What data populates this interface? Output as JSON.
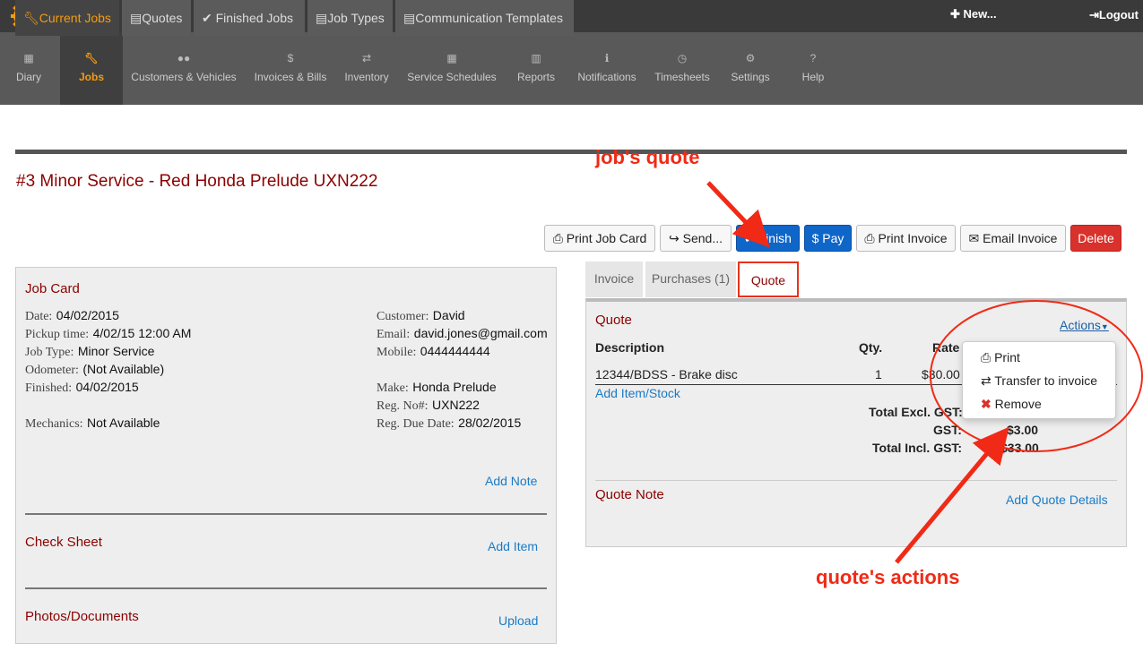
{
  "topbar": {
    "logo_icon": "gear-logo-icon",
    "new_label": "✚ New...",
    "logout_label": "Logout"
  },
  "nav": {
    "items": [
      {
        "label": "Diary",
        "icon": "calendar-icon"
      },
      {
        "label": "Jobs",
        "icon": "wrench-icon"
      },
      {
        "label": "Customers & Vehicles",
        "icon": "users-icon"
      },
      {
        "label": "Invoices & Bills",
        "icon": "dollar-icon"
      },
      {
        "label": "Inventory",
        "icon": "retweet-icon"
      },
      {
        "label": "Service Schedules",
        "icon": "calendar-icon"
      },
      {
        "label": "Reports",
        "icon": "chart-icon"
      },
      {
        "label": "Notifications",
        "icon": "info-icon"
      },
      {
        "label": "Timesheets",
        "icon": "clock-icon"
      },
      {
        "label": "Settings",
        "icon": "cogs-icon"
      },
      {
        "label": "Help",
        "icon": "question-icon"
      }
    ]
  },
  "subtabs": [
    {
      "label": "Current Jobs",
      "icon": "wrench-icon"
    },
    {
      "label": "Quotes",
      "icon": "file-icon"
    },
    {
      "label": "Finished Jobs",
      "icon": "check-icon"
    },
    {
      "label": "Job Types",
      "icon": "file-icon"
    },
    {
      "label": "Communication Templates",
      "icon": "file-icon"
    }
  ],
  "job": {
    "title": "#3 Minor Service - Red Honda Prelude UXN222"
  },
  "actions": {
    "print_job_card": "Print Job Card",
    "send": "Send...",
    "finish": "Finish",
    "pay": "$ Pay",
    "print_invoice": "Print Invoice",
    "email_invoice": "Email Invoice",
    "delete": "Delete"
  },
  "jobcard": {
    "title": "Job Card",
    "date_label": "Date:",
    "date": "04/02/2015",
    "pickup_label": "Pickup time:",
    "pickup": "4/02/15 12:00 AM",
    "jobtype_label": "Job Type:",
    "jobtype": "Minor Service",
    "odometer_label": "Odometer:",
    "odometer": "(Not Available)",
    "finished_label": "Finished:",
    "finished": "04/02/2015",
    "mechanics_label": "Mechanics:",
    "mechanics": "Not Available",
    "customer_label": "Customer:",
    "customer": "David",
    "email_label": "Email:",
    "email": "david.jones@gmail.com",
    "mobile_label": "Mobile:",
    "mobile": "0444444444",
    "make_label": "Make:",
    "make": "Honda Prelude",
    "regno_label": "Reg. No#:",
    "regno": "UXN222",
    "regdue_label": "Reg. Due Date:",
    "regdue": "28/02/2015",
    "add_note": "Add Note",
    "check_sheet": "Check Sheet",
    "add_item": "Add Item",
    "photos": "Photos/Documents",
    "upload": "Upload"
  },
  "right_tabs": [
    {
      "label": "Invoice"
    },
    {
      "label": "Purchases (1)"
    },
    {
      "label": "Quote"
    }
  ],
  "quote": {
    "title": "Quote",
    "actions_label": "Actions",
    "col_description": "Description",
    "col_qty": "Qty.",
    "col_rate": "Rate",
    "row_description": "12344/BDSS - Brake disc",
    "row_qty": "1",
    "row_rate": "$30.00",
    "add_item_stock": "Add Item/Stock",
    "total_excl_label": "Total Excl. GST:",
    "gst_label": "GST:",
    "gst_value": "$3.00",
    "total_incl_label": "Total Incl. GST:",
    "total_incl_value": "$33.00",
    "note_title": "Quote Note",
    "add_details": "Add Quote Details"
  },
  "dropdown": {
    "print": "Print",
    "transfer": "Transfer to invoice",
    "remove": "Remove"
  },
  "annotations": {
    "jobs_quote": "job's quote",
    "quotes_actions": "quote's actions",
    "color": "#f02a16"
  }
}
